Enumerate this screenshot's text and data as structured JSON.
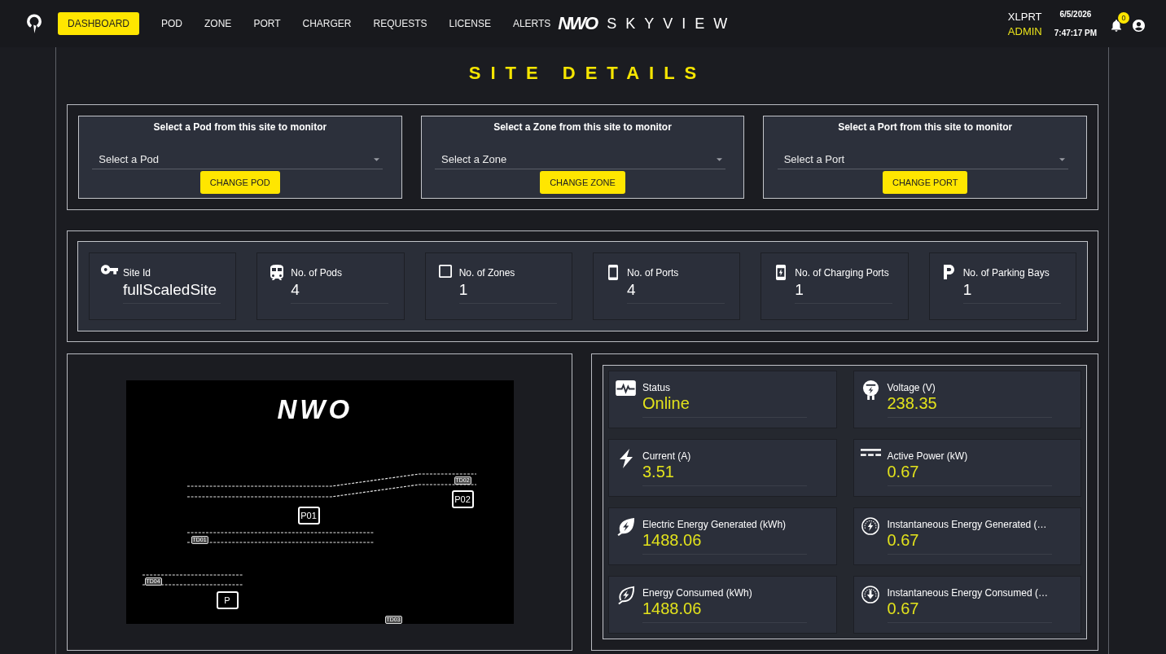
{
  "nav": {
    "items": [
      {
        "label": "DASHBOARD",
        "selected": true
      },
      {
        "label": "POD",
        "selected": false
      },
      {
        "label": "ZONE",
        "selected": false
      },
      {
        "label": "PORT",
        "selected": false
      },
      {
        "label": "CHARGER",
        "selected": false
      },
      {
        "label": "REQUESTS",
        "selected": false
      },
      {
        "label": "LICENSE",
        "selected": false
      },
      {
        "label": "ALERTS",
        "selected": false
      }
    ],
    "brand": {
      "logo": "NWO",
      "name": "SKYVIEW"
    },
    "user": {
      "name": "XLPRT",
      "role": "ADMIN"
    },
    "date": "6/5/2026",
    "time": "7:47:17 PM",
    "notification_count": "0"
  },
  "page_title": "SITE DETAILS",
  "selectors": [
    {
      "title": "Select a Pod from this site to monitor",
      "placeholder": "Select a Pod",
      "button": "CHANGE POD"
    },
    {
      "title": "Select a Zone from this site to monitor",
      "placeholder": "Select a Zone",
      "button": "CHANGE ZONE"
    },
    {
      "title": "Select a Port from this site to monitor",
      "placeholder": "Select a Port",
      "button": "CHANGE PORT"
    }
  ],
  "stats": [
    {
      "label": "Site Id",
      "value": "fullScaledSite"
    },
    {
      "label": "No. of Pods",
      "value": "4"
    },
    {
      "label": "No. of Zones",
      "value": "1"
    },
    {
      "label": "No. of Ports",
      "value": "4"
    },
    {
      "label": "No. of Charging Ports",
      "value": "1"
    },
    {
      "label": "No. of Parking Bays",
      "value": "1"
    }
  ],
  "site_map": {
    "logo": "NWO",
    "markers": [
      {
        "label": "P02"
      },
      {
        "label": "P01"
      },
      {
        "label": "P"
      }
    ],
    "track_labels": [
      "TD02",
      "TD01",
      "TD04",
      "TD03"
    ]
  },
  "metrics": [
    {
      "label": "Status",
      "value": "Online"
    },
    {
      "label": "Voltage (V)",
      "value": "238.35"
    },
    {
      "label": "Current (A)",
      "value": "3.51"
    },
    {
      "label": "Active Power (kW)",
      "value": "0.67"
    },
    {
      "label": "Electric Energy Generated (kWh)",
      "value": "1488.06"
    },
    {
      "label": "Instantaneous Energy Generated (…",
      "value": "0.67"
    },
    {
      "label": "Energy Consumed (kWh)",
      "value": "1488.06"
    },
    {
      "label": "Instantaneous Energy Consumed (…",
      "value": "0.67"
    }
  ]
}
